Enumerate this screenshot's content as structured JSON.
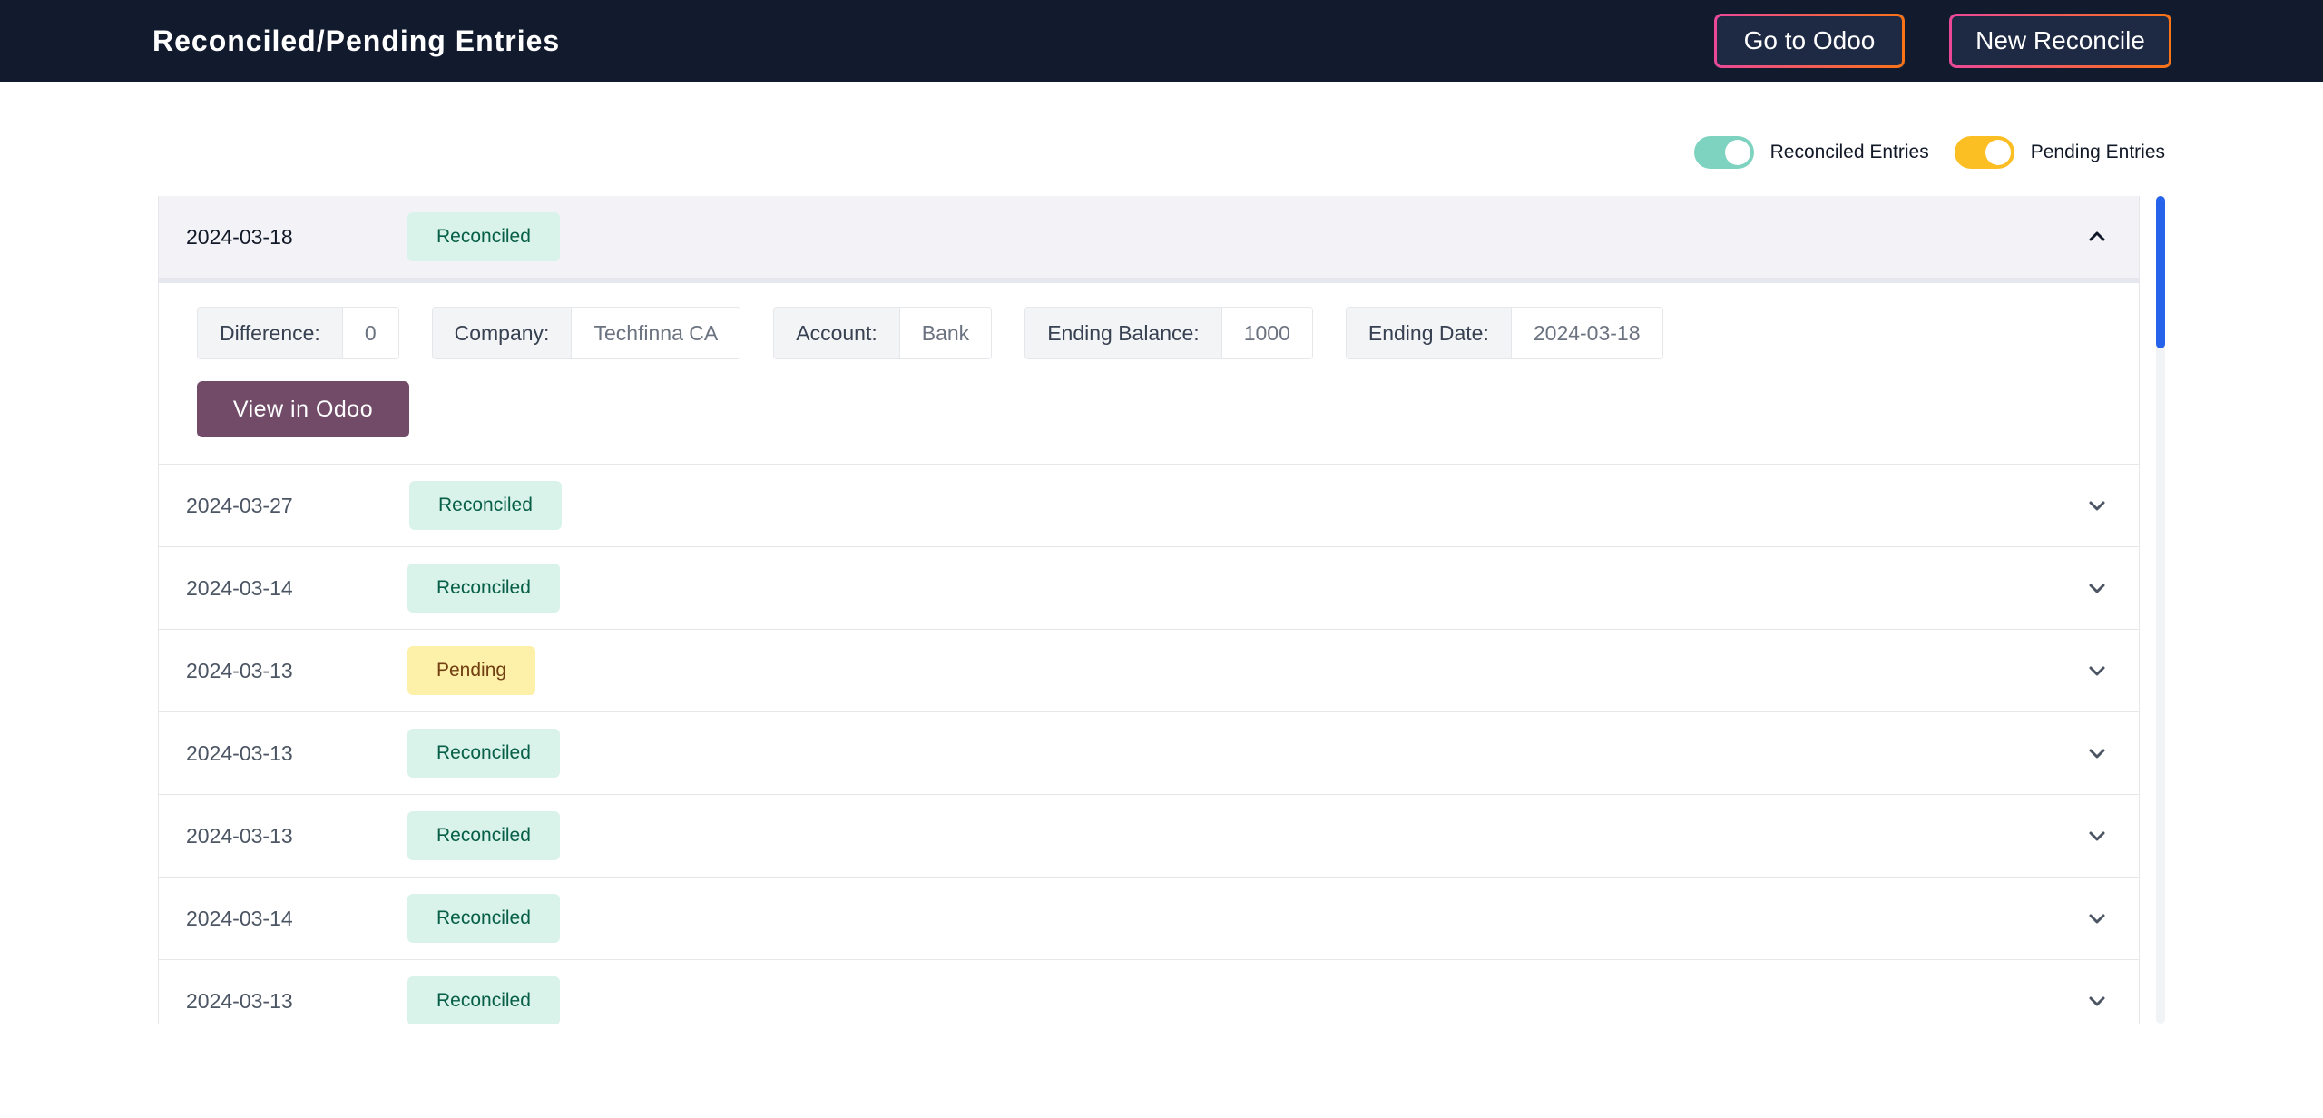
{
  "header": {
    "title": "Reconciled/Pending Entries",
    "go_odoo_label": "Go to Odoo",
    "new_reconcile_label": "New Reconcile"
  },
  "filters": {
    "reconciled_label": "Reconciled Entries",
    "pending_label": "Pending Entries",
    "reconciled_on": true,
    "pending_on": true
  },
  "colors": {
    "header_bg": "#121a2e",
    "reconciled_toggle": "#7dd3bf",
    "pending_toggle": "#fbbf24",
    "view_button": "#714b67",
    "scroll_thumb": "#2563eb"
  },
  "expanded": {
    "date": "2024-03-18",
    "status": "Reconciled",
    "fields": [
      {
        "key": "Difference:",
        "value": "0"
      },
      {
        "key": "Company:",
        "value": "Techfinna CA"
      },
      {
        "key": "Account:",
        "value": "Bank"
      },
      {
        "key": "Ending Balance:",
        "value": "1000"
      },
      {
        "key": "Ending Date:",
        "value": "2024-03-18"
      }
    ],
    "view_label": "View in Odoo"
  },
  "rows": [
    {
      "date": "2024-03-27",
      "status": "Reconciled"
    },
    {
      "date": "2024-03-14",
      "status": "Reconciled"
    },
    {
      "date": "2024-03-13",
      "status": "Pending"
    },
    {
      "date": "2024-03-13",
      "status": "Reconciled"
    },
    {
      "date": "2024-03-13",
      "status": "Reconciled"
    },
    {
      "date": "2024-03-14",
      "status": "Reconciled"
    },
    {
      "date": "2024-03-13",
      "status": "Reconciled"
    }
  ]
}
